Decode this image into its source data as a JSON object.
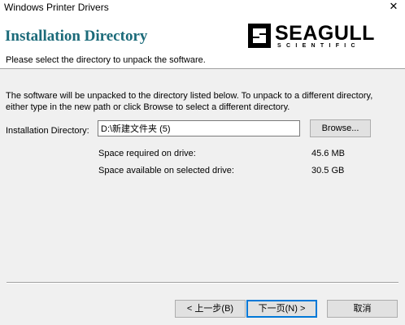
{
  "window": {
    "title": "Windows Printer Drivers",
    "close_glyph": "✕"
  },
  "header": {
    "heading": "Installation Directory",
    "subheading": "Please select the directory to unpack the software.",
    "logo": {
      "wordmark": "SEAGULL",
      "sub": "SCIENTIFIC",
      "icon": "seagull-logo-icon",
      "accent": "#1b6a79"
    }
  },
  "body": {
    "intro_line1": "The software will be unpacked to the directory listed below.  To unpack to a different directory,",
    "intro_line2": "either type in the new path or click Browse to select a different directory.",
    "dir_label": "Installation Directory:",
    "dir_value": "D:\\新建文件夹 (5)",
    "browse_label": "Browse...",
    "space_required_label": "Space required on drive:",
    "space_required_value": "45.6 MB",
    "space_available_label": "Space available on selected drive:",
    "space_available_value": "30.5 GB"
  },
  "footer": {
    "back_label": "< 上一步(B)",
    "next_label": "下一页(N) >",
    "cancel_label": "取消"
  },
  "colors": {
    "window_bg": "#f0f0f0",
    "button_bg": "#e1e1e1",
    "focus_border": "#0078d7"
  }
}
